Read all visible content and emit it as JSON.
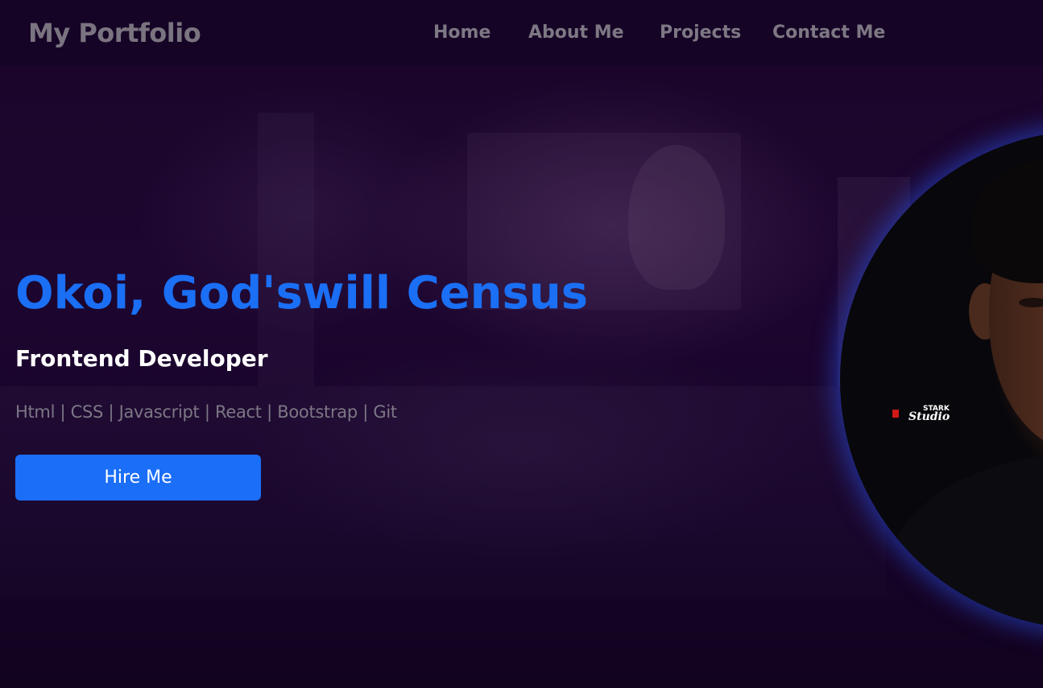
{
  "navbar": {
    "brand": "My Portfolio",
    "links": [
      {
        "label": "Home"
      },
      {
        "label": "About Me"
      },
      {
        "label": "Projects"
      },
      {
        "label": "Contact Me"
      }
    ]
  },
  "hero": {
    "name": "Okoi, God'swill Census",
    "role": "Frontend Developer",
    "skills": "Html | CSS | Javascript | React | Bootstrap | Git",
    "cta_label": "Hire Me"
  },
  "profile_photo": {
    "watermark_line1": "STARK",
    "watermark_line2": "Studio"
  },
  "colors": {
    "background": "#12031f",
    "accent": "#1b6ef8",
    "muted_text": "#7c7785",
    "photo_glow": "#2850e6"
  }
}
